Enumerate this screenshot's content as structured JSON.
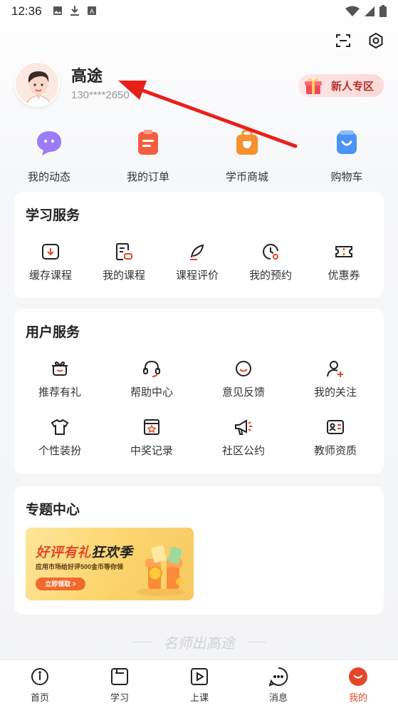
{
  "status_bar": {
    "time": "12:36"
  },
  "profile": {
    "username": "高途",
    "phone": "130****2650",
    "newbie_label": "新人专区"
  },
  "quick_actions": [
    {
      "label": "我的动态",
      "icon": "chat-bubble-icon",
      "color": "#8a6cf0"
    },
    {
      "label": "我的订单",
      "icon": "clipboard-icon",
      "color": "#f25a3c"
    },
    {
      "label": "学币商城",
      "icon": "shopping-bag-icon",
      "color": "#f58a2a"
    },
    {
      "label": "购物车",
      "icon": "cart-icon",
      "color": "#3c8df5"
    }
  ],
  "study_services": {
    "title": "学习服务",
    "items": [
      {
        "label": "缓存课程",
        "icon": "download-icon"
      },
      {
        "label": "我的课程",
        "icon": "course-icon"
      },
      {
        "label": "课程评价",
        "icon": "feather-icon"
      },
      {
        "label": "我的预约",
        "icon": "clock-icon"
      },
      {
        "label": "优惠券",
        "icon": "coupon-icon"
      }
    ]
  },
  "user_services": {
    "title": "用户服务",
    "items": [
      {
        "label": "推荐有礼",
        "icon": "gift-icon"
      },
      {
        "label": "帮助中心",
        "icon": "headset-icon"
      },
      {
        "label": "意见反馈",
        "icon": "smile-icon"
      },
      {
        "label": "我的关注",
        "icon": "user-plus-icon"
      },
      {
        "label": "个性装扮",
        "icon": "tshirt-icon"
      },
      {
        "label": "中奖记录",
        "icon": "award-icon"
      },
      {
        "label": "社区公约",
        "icon": "megaphone-icon"
      },
      {
        "label": "教师资质",
        "icon": "id-card-icon"
      }
    ]
  },
  "topic_center": {
    "title": "专题中心",
    "banner": {
      "title_red": "好评有礼",
      "title_dark": "狂欢季",
      "subtitle": "应用市场给好评500金币等你领",
      "button": "立即领取 >"
    }
  },
  "slogan": "名师出高途",
  "bottom_nav": [
    {
      "label": "首页",
      "icon": "home-icon",
      "active": false
    },
    {
      "label": "学习",
      "icon": "book-icon",
      "active": false
    },
    {
      "label": "上课",
      "icon": "play-icon",
      "active": false
    },
    {
      "label": "消息",
      "icon": "message-icon",
      "active": false
    },
    {
      "label": "我的",
      "icon": "profile-icon",
      "active": true
    }
  ],
  "colors": {
    "accent": "#e5462a",
    "annotation_arrow": "#e8201a"
  }
}
